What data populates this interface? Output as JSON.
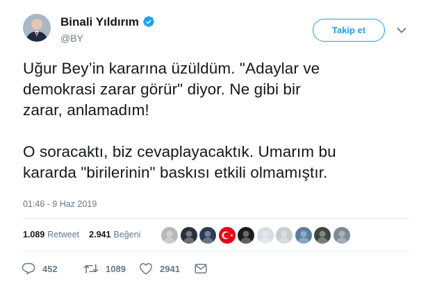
{
  "user": {
    "name": "Binali Yıldırım",
    "handle": "@BY",
    "verified": true
  },
  "follow_button": "Takip et",
  "tweet": {
    "text": "Uğur Bey’in kararına üzüldüm. \"Adaylar ve\ndemokrasi zarar görür\" diyor. Ne gibi bir\nzarar, anlamadım!\n\nO soracaktı, biz cevaplayacaktık. Umarım bu\nkararda \"birilerinin\" baskısı etkili olmamıştır.",
    "timestamp": "01:46 - 9 Haz 2019"
  },
  "stats": {
    "retweets_count": "1.089",
    "retweets_label": "Retweet",
    "likes_count": "2.941",
    "likes_label": "Beğeni"
  },
  "likers": [
    {
      "icon": "avatar-1",
      "color": "#b8b8b8"
    },
    {
      "icon": "avatar-2",
      "color": "#2b2f3a"
    },
    {
      "icon": "avatar-3",
      "color": "#2a3b55"
    },
    {
      "icon": "turkish-flag-avatar",
      "color": "#e30a17"
    },
    {
      "icon": "avatar-5",
      "color": "#1b1b1b"
    },
    {
      "icon": "avatar-6",
      "color": "#d8dde3"
    },
    {
      "icon": "avatar-7",
      "color": "#c7ccd2"
    },
    {
      "icon": "avatar-8",
      "color": "#5a7fa3"
    },
    {
      "icon": "avatar-9",
      "color": "#3a4a3e"
    },
    {
      "icon": "avatar-10",
      "color": "#7d8a95"
    }
  ],
  "actions": {
    "replies": "452",
    "retweets": "1089",
    "likes": "2941"
  },
  "colors": {
    "accent": "#1da1f2",
    "secondary_text": "#657786",
    "divider": "#e6ecf0"
  }
}
